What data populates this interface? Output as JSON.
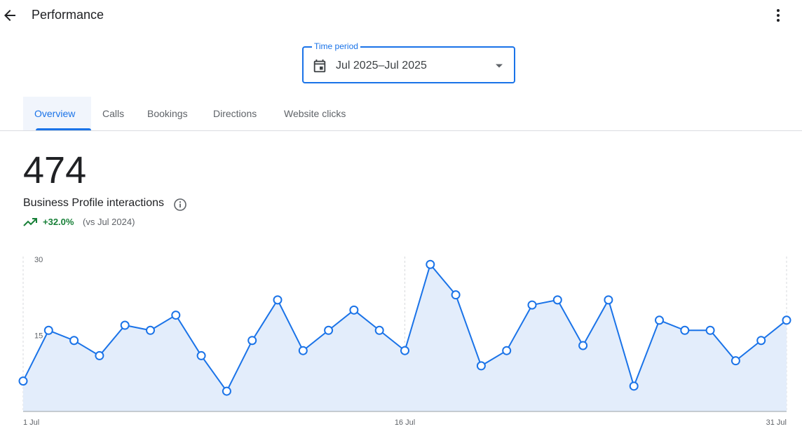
{
  "header": {
    "title": "Performance",
    "back_icon": "arrow-back-icon",
    "more_icon": "more-vert-icon"
  },
  "time_period": {
    "label": "Time period",
    "value": "Jul 2025–Jul 2025",
    "icon": "calendar-icon"
  },
  "tabs": [
    {
      "label": "Overview",
      "active": true
    },
    {
      "label": "Calls"
    },
    {
      "label": "Bookings"
    },
    {
      "label": "Directions"
    },
    {
      "label": "Website clicks"
    }
  ],
  "summary": {
    "total": "474",
    "label": "Business Profile interactions",
    "change": "+32.0%",
    "comparison": "(vs Jul 2024)"
  },
  "colors": {
    "accent": "#1a73e8",
    "positive": "#188038",
    "area_fill": "#e3edfb"
  },
  "chart_data": {
    "type": "line",
    "x": [
      1,
      2,
      3,
      4,
      5,
      6,
      7,
      8,
      9,
      10,
      11,
      12,
      13,
      14,
      15,
      16,
      17,
      18,
      19,
      20,
      21,
      22,
      23,
      24,
      25,
      26,
      27,
      28,
      29,
      30,
      31
    ],
    "x_ticks": [
      {
        "value": 1,
        "label": "1 Jul"
      },
      {
        "value": 16,
        "label": "16 Jul"
      },
      {
        "value": 31,
        "label": "31 Jul"
      }
    ],
    "y_ticks": [
      15,
      30
    ],
    "ylim": [
      0,
      30
    ],
    "series": [
      {
        "values": [
          6,
          16,
          14,
          11,
          17,
          16,
          19,
          11,
          4,
          14,
          22,
          12,
          16,
          20,
          16,
          12,
          29,
          23,
          9,
          12,
          21,
          22,
          13,
          22,
          5,
          18,
          16,
          16,
          10,
          14,
          18
        ]
      }
    ]
  }
}
